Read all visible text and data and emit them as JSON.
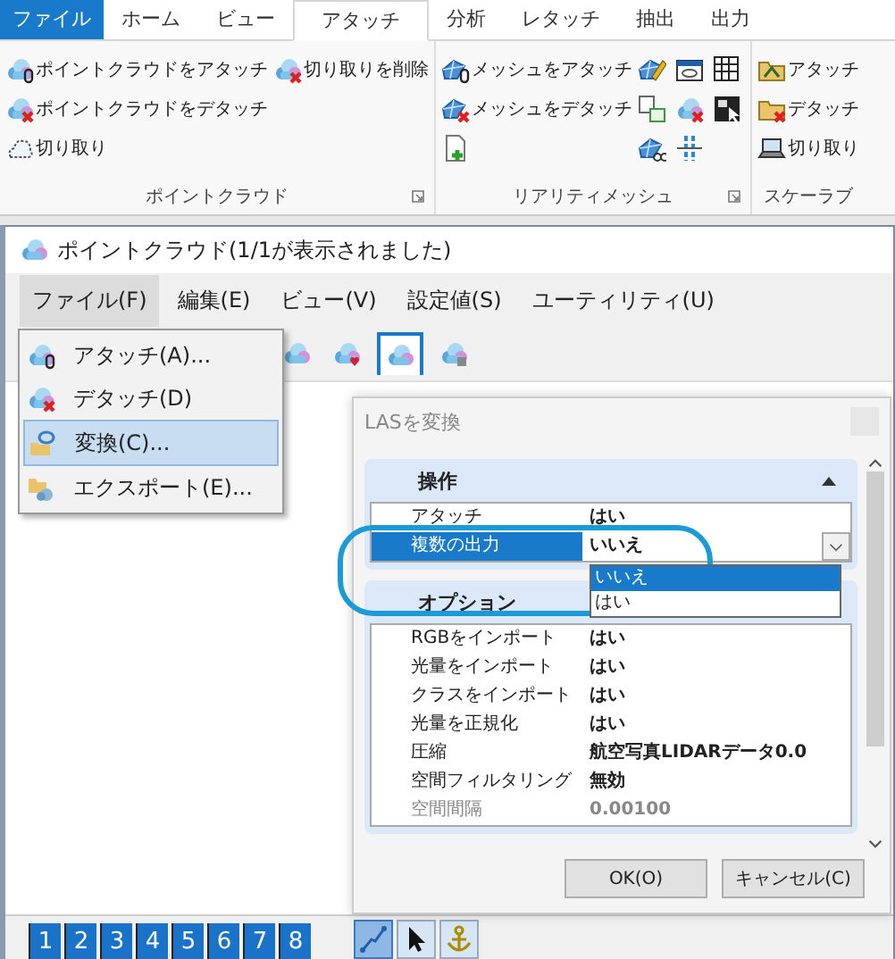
{
  "ribbon": {
    "tabs": [
      {
        "label": "ファイル",
        "kind": "file",
        "selected": false
      },
      {
        "label": "ホーム",
        "kind": "tab",
        "selected": false
      },
      {
        "label": "ビュー",
        "kind": "tab",
        "selected": false
      },
      {
        "label": "アタッチ",
        "kind": "tab",
        "selected": true
      },
      {
        "label": "分析",
        "kind": "tab",
        "selected": false
      },
      {
        "label": "レタッチ",
        "kind": "tab",
        "selected": false
      },
      {
        "label": "抽出",
        "kind": "tab",
        "selected": false
      },
      {
        "label": "出力",
        "kind": "tab",
        "selected": false
      }
    ],
    "groups": [
      {
        "title": "ポイントクラウド",
        "launcher": true,
        "columns": [
          [
            {
              "label": "ポイントクラウドをアタッチ",
              "kind": "cloudclip"
            },
            {
              "label": "ポイントクラウドをデタッチ",
              "kind": "cloudx"
            },
            {
              "label": "切り取り",
              "kind": "cloudout"
            }
          ],
          [
            {
              "label": "切り取りを削除",
              "kind": "cloudx"
            }
          ]
        ]
      },
      {
        "title": "リアリティメッシュ",
        "launcher": true,
        "columns": [
          [
            {
              "label": "メッシュをアタッチ",
              "kind": "meshclip"
            },
            {
              "label": "メッシュをデタッチ",
              "kind": "meshx"
            },
            {
              "kind": "fileplus"
            }
          ],
          [
            {
              "kind": "pencil"
            },
            {
              "kind": "copy"
            },
            {
              "kind": "meshcut"
            }
          ],
          [
            {
              "kind": "window"
            },
            {
              "kind": "cloudx"
            },
            {
              "kind": "split"
            }
          ],
          [
            {
              "kind": "grid"
            },
            {
              "kind": "panel"
            }
          ]
        ]
      },
      {
        "title": "スケーラブ",
        "columns": [
          [
            {
              "label": "アタッチ",
              "kind": "folder"
            },
            {
              "label": "デタッチ",
              "kind": "folderx"
            },
            {
              "label": "切り取り",
              "kind": "laptop"
            }
          ]
        ]
      }
    ]
  },
  "window": {
    "title": "ポイントクラウド(1/1が表示されました)",
    "menu": [
      {
        "label": "ファイル(F)",
        "selected": true
      },
      {
        "label": "編集(E)",
        "selected": false
      },
      {
        "label": "ビュー(V)",
        "selected": false
      },
      {
        "label": "設定値(S)",
        "selected": false
      },
      {
        "label": "ユーティリティ(U)",
        "selected": false
      }
    ],
    "toolbar": [
      {
        "kind": "cloud",
        "selected": false
      },
      {
        "kind": "cloudheart",
        "selected": false
      },
      {
        "kind": "cloud",
        "selected": true
      },
      {
        "kind": "cloudlock",
        "selected": false
      }
    ],
    "file_menu": [
      {
        "label": "アタッチ(A)...",
        "kind": "cloudclip",
        "selected": false
      },
      {
        "label": "デタッチ(D)",
        "kind": "cloudx",
        "selected": false
      },
      {
        "label": "変換(C)...",
        "kind": "convert",
        "selected": true
      },
      {
        "label": "エクスポート(E)...",
        "kind": "export",
        "selected": false
      }
    ]
  },
  "dialog": {
    "title": "LASを変換",
    "sections": [
      {
        "title": "操作",
        "expanded": true,
        "rows": [
          {
            "label": "アタッチ",
            "value": "はい",
            "selected": false,
            "disabled": false
          },
          {
            "label": "複数の出力",
            "value": "いいえ",
            "selected": true,
            "disabled": false
          }
        ]
      },
      {
        "title": "オプション",
        "rows": [
          {
            "label": "RGBをインポート",
            "value": "はい",
            "selected": false,
            "disabled": false
          },
          {
            "label": "光量をインポート",
            "value": "はい",
            "selected": false,
            "disabled": false
          },
          {
            "label": "クラスをインポート",
            "value": "はい",
            "selected": false,
            "disabled": false
          },
          {
            "label": "光量を正規化",
            "value": "はい",
            "selected": false,
            "disabled": false
          },
          {
            "label": "圧縮",
            "value": "航空写真LIDARデータ0.0",
            "selected": false,
            "disabled": false
          },
          {
            "label": "空間フィルタリング",
            "value": "無効",
            "selected": false,
            "disabled": false
          },
          {
            "label": "空間間隔",
            "value": "0.00100",
            "selected": false,
            "disabled": true
          }
        ]
      }
    ],
    "options": [
      {
        "label": "いいえ",
        "selected": true
      },
      {
        "label": "はい",
        "selected": false
      }
    ],
    "buttons": [
      "OK(O)",
      "キャンセル(C)"
    ]
  },
  "bottom": {
    "views": [
      "1",
      "2",
      "3",
      "4",
      "5",
      "6",
      "7",
      "8"
    ],
    "tools": [
      {
        "kind": "line",
        "selected": true
      },
      {
        "kind": "pointer",
        "selected": false
      },
      {
        "kind": "anchor",
        "selected": false
      }
    ]
  }
}
